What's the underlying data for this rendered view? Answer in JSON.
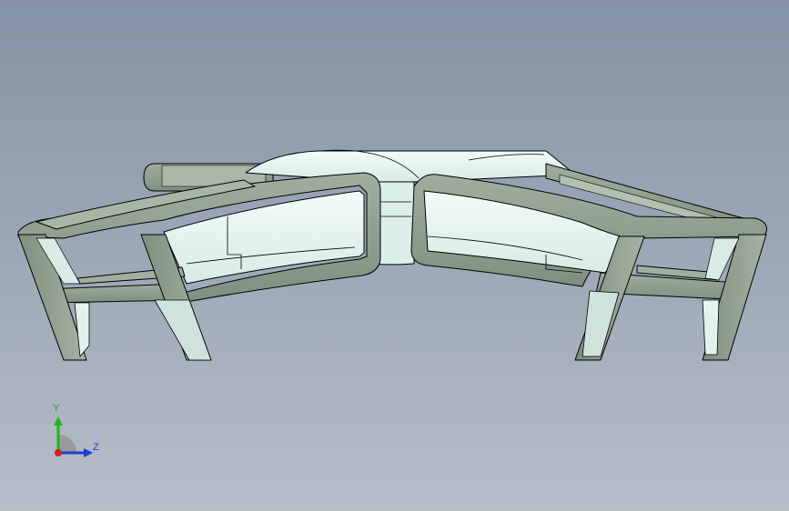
{
  "viewport": {
    "background_top": "#8593a6",
    "background_bottom": "#b6bec8"
  },
  "model": {
    "fill_color": "#8f9f8f",
    "edge_color": "#000000",
    "inner_face_color": "#e4f3ee",
    "highlight_color": "#f3fbf8"
  },
  "triad": {
    "y_label": "Y",
    "z_label": "Z",
    "y_color": "#1fb61f",
    "z_color": "#1f3fd4",
    "x_color": "#d41f1f",
    "y_label_color": "#2a9b2a",
    "z_label_color": "#1f3fd4"
  }
}
